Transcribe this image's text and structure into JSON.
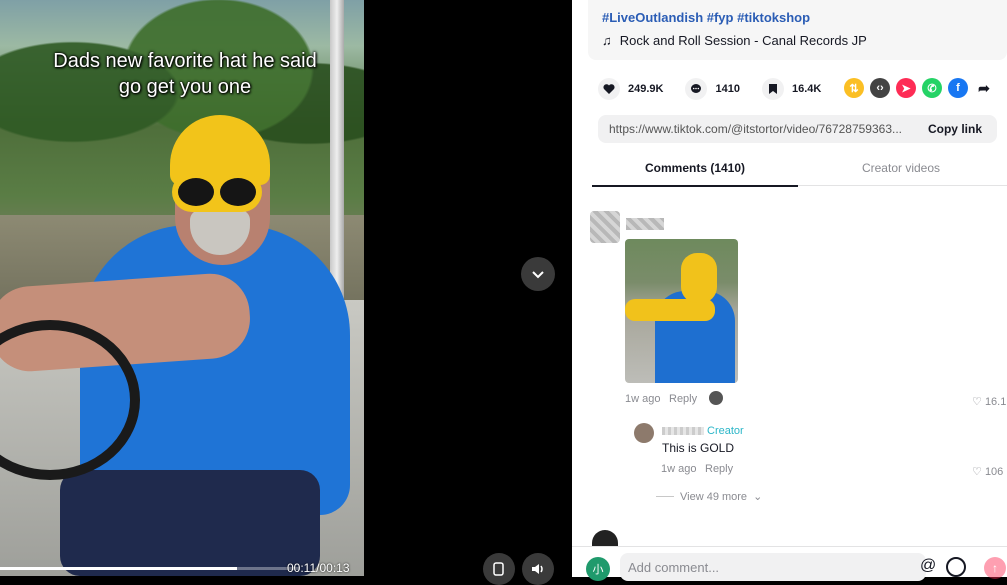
{
  "video": {
    "caption": "Dads new favorite hat he said go get you one",
    "time": "00:11/00:13",
    "progress": 0.79
  },
  "post": {
    "hashtags": "#LiveOutlandish #fyp #tiktokshop",
    "music": "Rock and Roll Session - Canal Records JP"
  },
  "actions": {
    "likes": "249.9K",
    "comments": "1410",
    "saves": "16.4K"
  },
  "share_icons": [
    "repost-icon",
    "embed-icon",
    "send-icon",
    "whatsapp-icon",
    "facebook-icon",
    "share-arrow-icon"
  ],
  "link": {
    "url": "https://www.tiktok.com/@itstortor/video/76728759363...",
    "copy_label": "Copy link"
  },
  "tabs": {
    "comments": "Comments (1410)",
    "creator": "Creator videos"
  },
  "comment1": {
    "time": "1w ago",
    "reply_label": "Reply",
    "likes": "16.1"
  },
  "reply1": {
    "creator_label": "Creator",
    "text": "This is GOLD",
    "time": "1w ago",
    "reply_label": "Reply",
    "likes": "106"
  },
  "view_more": "View 49 more",
  "comment_input": {
    "placeholder": "Add comment...",
    "avatar_letter": "小",
    "at_symbol": "@"
  },
  "colors": {
    "accent": "#fe2c55",
    "creator": "#2bb6c8",
    "hashtag": "#2b5db5"
  }
}
